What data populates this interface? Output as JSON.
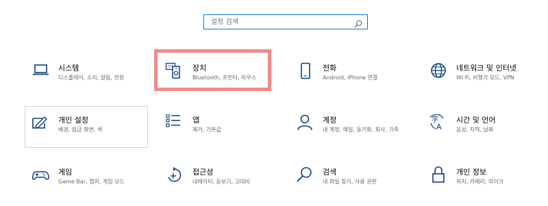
{
  "search": {
    "placeholder": "설정 검색"
  },
  "tiles": [
    {
      "title": "시스템",
      "desc": "디스플레이, 소리, 알림, 전원",
      "icon": "laptop-icon"
    },
    {
      "title": "장치",
      "desc": "Bluetooth, 프린터, 마우스",
      "icon": "devices-icon"
    },
    {
      "title": "전화",
      "desc": "Android, iPhone 연결",
      "icon": "phone-icon"
    },
    {
      "title": "네트워크 및 인터넷",
      "desc": "Wi-Fi, 비행기 모드, VPN",
      "icon": "globe-icon"
    },
    {
      "title": "개인 설정",
      "desc": "배경, 잠금 화면, 색",
      "icon": "personalization-icon"
    },
    {
      "title": "앱",
      "desc": "제거, 기본값",
      "icon": "apps-list-icon"
    },
    {
      "title": "계정",
      "desc": "내 계정, 메일, 동기화, 회사, 가족",
      "icon": "person-icon"
    },
    {
      "title": "시간 및 언어",
      "desc": "음성, 지역, 날짜",
      "icon": "time-language-icon"
    },
    {
      "title": "게임",
      "desc": "Game Bar, 캡처, 게임 모드",
      "icon": "gamepad-icon"
    },
    {
      "title": "접근성",
      "desc": "내레이터, 돋보기, 고대비",
      "icon": "accessibility-icon"
    },
    {
      "title": "검색",
      "desc": "내 파일 찾기, 사용 권한",
      "icon": "magnifier-icon"
    },
    {
      "title": "개인 정보",
      "desc": "위치, 카메라, 마이크",
      "icon": "lock-icon"
    }
  ],
  "colors": {
    "accent": "#0078d7",
    "highlight": "#f08a88",
    "icon": "#0a3d82"
  }
}
